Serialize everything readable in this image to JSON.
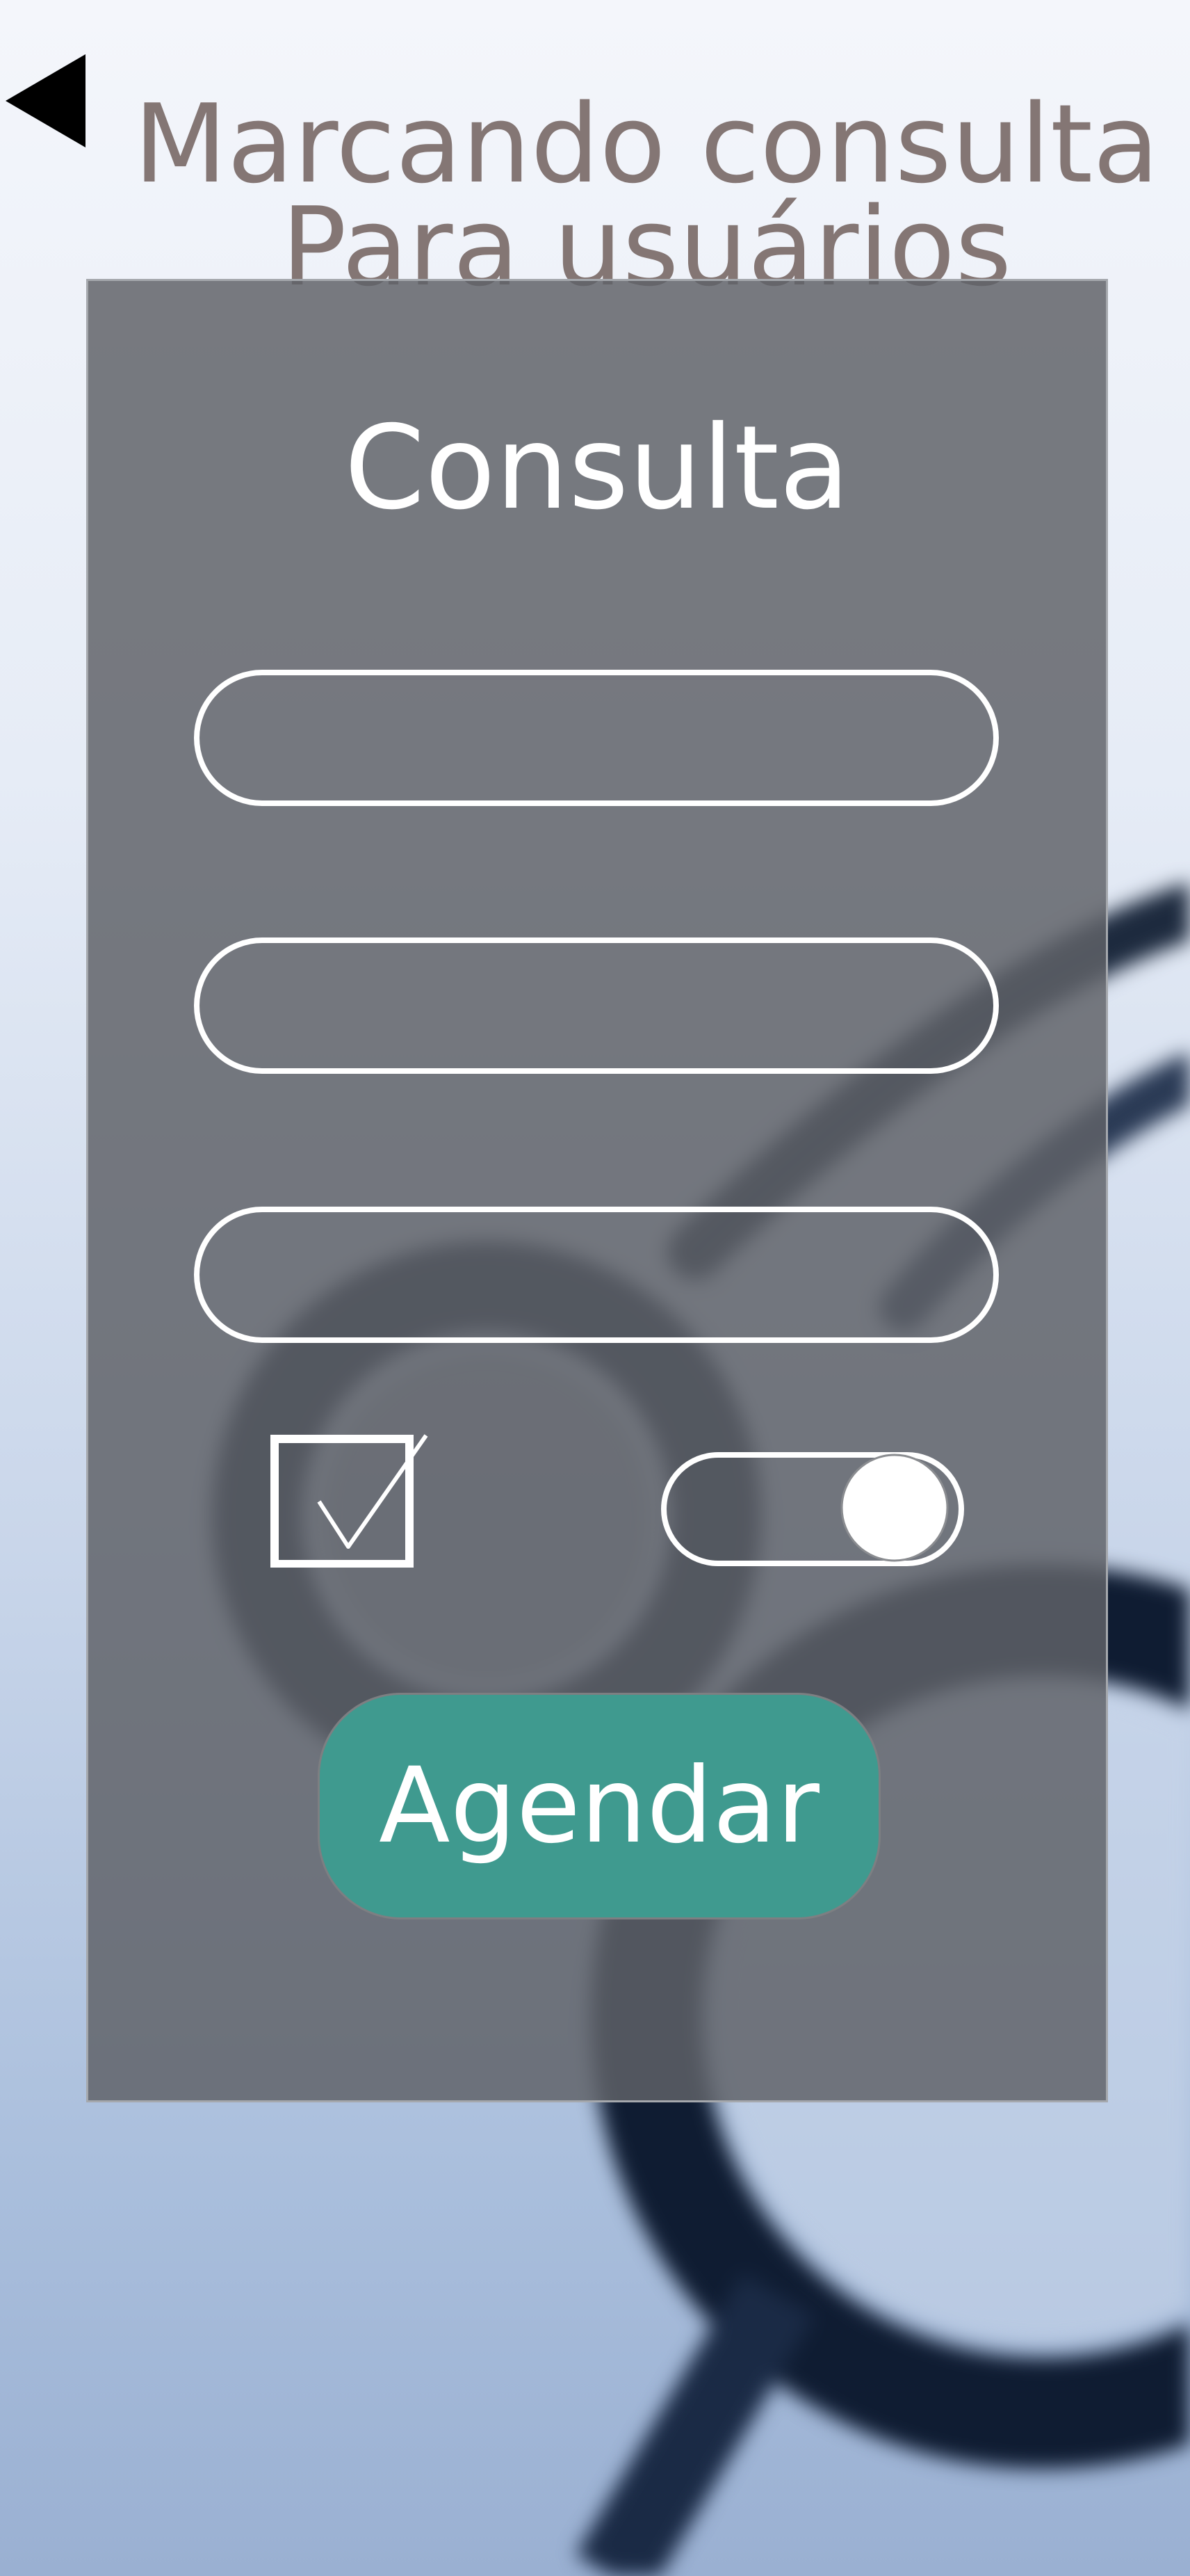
{
  "header": {
    "back_icon": "back-triangle-icon",
    "title_line1": "Marcando consulta",
    "title_line2": "Para usuários",
    "title_color": "#847674"
  },
  "form": {
    "title": "Consulta",
    "fields": [
      {
        "value": "",
        "placeholder": ""
      },
      {
        "value": "",
        "placeholder": ""
      },
      {
        "value": "",
        "placeholder": ""
      }
    ],
    "checkbox": {
      "checked": true,
      "icon": "checkmark-icon"
    },
    "toggle": {
      "on": true
    },
    "submit_label": "Agendar",
    "submit_color": "#3f9a8f"
  },
  "background": {
    "image": "stethoscope"
  }
}
